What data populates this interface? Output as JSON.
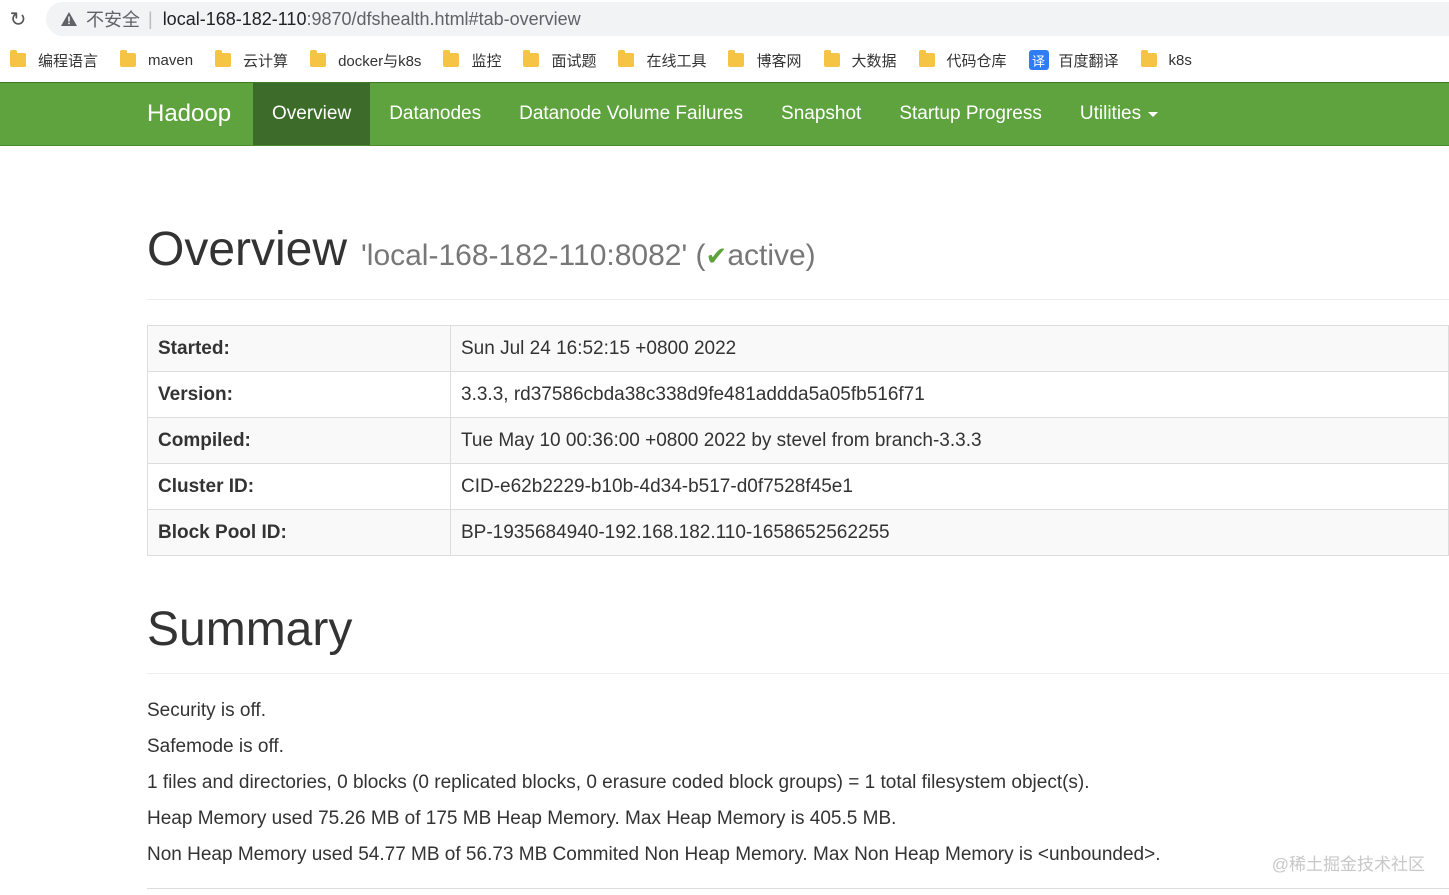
{
  "browser": {
    "insecure_label": "不安全",
    "separator": "|",
    "url_host": "local-168-182-110",
    "url_path": ":9870/dfshealth.html#tab-overview"
  },
  "bookmarks": [
    {
      "label": "编程语言"
    },
    {
      "label": "maven"
    },
    {
      "label": "云计算"
    },
    {
      "label": "docker与k8s"
    },
    {
      "label": "监控"
    },
    {
      "label": "面试题"
    },
    {
      "label": "在线工具"
    },
    {
      "label": "博客网"
    },
    {
      "label": "大数据"
    },
    {
      "label": "代码仓库"
    },
    {
      "label": "百度翻译",
      "icon_text": "译"
    },
    {
      "label": "k8s"
    }
  ],
  "navbar": {
    "brand": "Hadoop",
    "items": [
      {
        "label": "Overview"
      },
      {
        "label": "Datanodes"
      },
      {
        "label": "Datanode Volume Failures"
      },
      {
        "label": "Snapshot"
      },
      {
        "label": "Startup Progress"
      },
      {
        "label": "Utilities"
      }
    ]
  },
  "overview": {
    "title": "Overview",
    "node_prefix": "'local-168-182-110:8082' (",
    "check": "✔",
    "status": "active)",
    "rows": [
      {
        "key": "Started:",
        "value": "Sun Jul 24 16:52:15 +0800 2022"
      },
      {
        "key": "Version:",
        "value": "3.3.3, rd37586cbda38c338d9fe481addda5a05fb516f71"
      },
      {
        "key": "Compiled:",
        "value": "Tue May 10 00:36:00 +0800 2022 by stevel from branch-3.3.3"
      },
      {
        "key": "Cluster ID:",
        "value": "CID-e62b2229-b10b-4d34-b517-d0f7528f45e1"
      },
      {
        "key": "Block Pool ID:",
        "value": "BP-1935684940-192.168.182.110-1658652562255"
      }
    ]
  },
  "summary": {
    "title": "Summary",
    "lines": [
      "Security is off.",
      "Safemode is off.",
      "1 files and directories, 0 blocks (0 replicated blocks, 0 erasure coded block groups) = 1 total filesystem object(s).",
      "Heap Memory used 75.26 MB of 175 MB Heap Memory. Max Heap Memory is 405.5 MB.",
      "Non Heap Memory used 54.77 MB of 56.73 MB Commited Non Heap Memory. Max Non Heap Memory is <unbounded>."
    ]
  },
  "watermark": "@稀土掘金技术社区",
  "colors": {
    "navbar": "#5fa33e",
    "navbar_active": "#3d6b2a",
    "folder": "#f6c445",
    "translate": "#2f7cf6"
  }
}
